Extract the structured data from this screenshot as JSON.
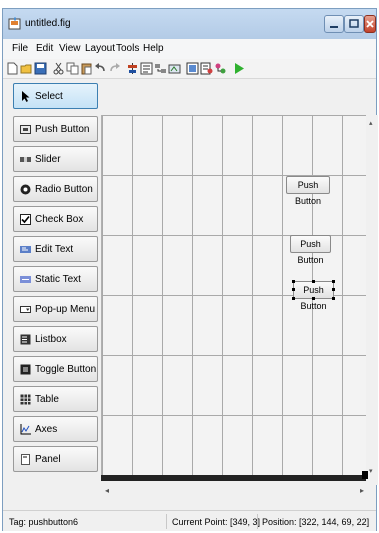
{
  "window": {
    "title": "untitled.fig"
  },
  "menu": [
    "File",
    "Edit",
    "View",
    "Layout",
    "Tools",
    "Help"
  ],
  "toolbar": [
    "new-file-icon",
    "open-folder-icon",
    "save-icon",
    "cut-icon",
    "copy-icon",
    "paste-icon",
    "undo-icon",
    "redo-icon",
    "align-objects-icon",
    "menu-editor-icon",
    "tab-order-icon",
    "toolbar-editor-icon",
    "mfile-editor-icon",
    "property-inspector-icon",
    "object-browser-icon",
    "run-figure-icon"
  ],
  "palette": [
    {
      "label": "Select",
      "icon": "arrow-cursor-icon",
      "selected": true
    },
    {
      "label": "Push Button",
      "icon": "push-button-icon"
    },
    {
      "label": "Slider",
      "icon": "slider-icon"
    },
    {
      "label": "Radio Button",
      "icon": "radio-button-icon"
    },
    {
      "label": "Check Box",
      "icon": "check-box-icon"
    },
    {
      "label": "Edit Text",
      "icon": "edit-text-icon"
    },
    {
      "label": "Static Text",
      "icon": "static-text-icon"
    },
    {
      "label": "Pop-up Menu",
      "icon": "popup-menu-icon"
    },
    {
      "label": "Listbox",
      "icon": "listbox-icon"
    },
    {
      "label": "Toggle Button",
      "icon": "toggle-button-icon"
    },
    {
      "label": "Table",
      "icon": "table-icon"
    },
    {
      "label": "Axes",
      "icon": "axes-icon"
    },
    {
      "label": "Panel",
      "icon": "panel-icon"
    }
  ],
  "canvas_buttons": [
    {
      "label": "Push Button",
      "selected": false
    },
    {
      "label": "Push Button",
      "selected": false
    },
    {
      "label": "Push Button",
      "selected": true
    }
  ],
  "scroll": {
    "up": "▴",
    "down": "▾",
    "left": "◂",
    "right": "▸"
  },
  "status": {
    "tag": "Tag: pushbutton6",
    "current_point": "Current Point: [349, 3]",
    "position": "Position: [322, 144, 69, 22]"
  },
  "colors": {
    "titlebar": "#b9d1ea",
    "close_button": "#c94a32",
    "selection_handle": "#000000",
    "run_icon": "#2fb12f"
  }
}
